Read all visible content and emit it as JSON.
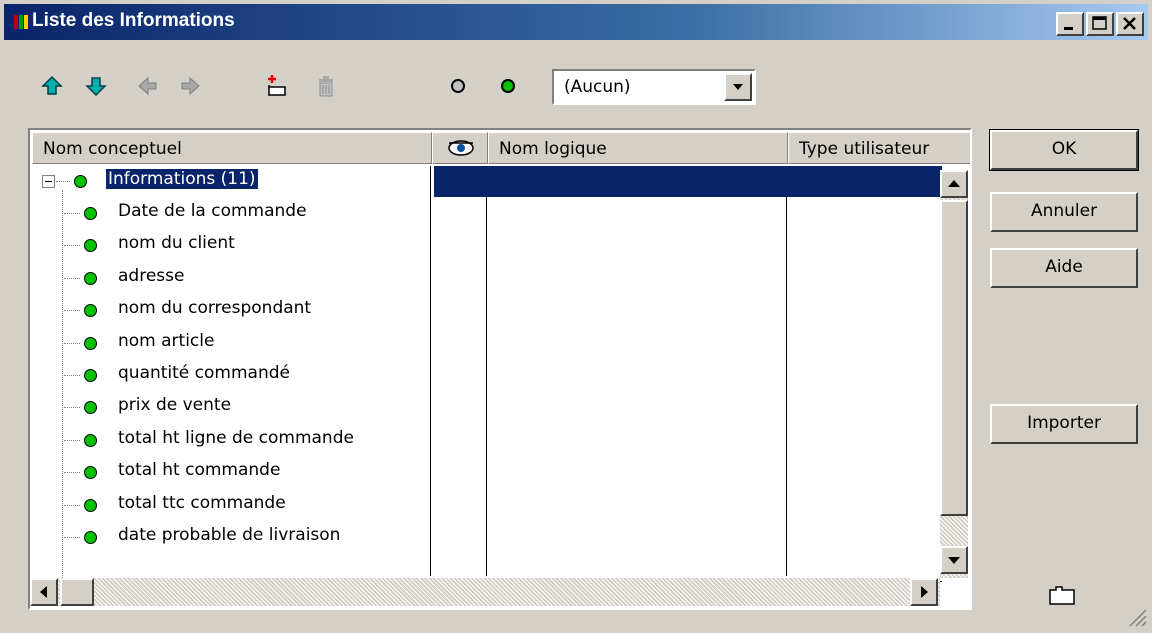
{
  "window": {
    "title": "Liste des Informations"
  },
  "toolbar": {
    "icons": [
      "move-up-icon",
      "move-down-icon",
      "move-left-icon",
      "move-right-icon",
      "add-item-icon",
      "delete-icon",
      "circle-empty-icon",
      "circle-green-icon"
    ],
    "filter_value": "(Aucun)"
  },
  "grid": {
    "columns": [
      "Nom conceptuel",
      "",
      "Nom logique",
      "Type utilisateur"
    ],
    "root": {
      "label": "Informations (11)"
    },
    "items": [
      "Date de la commande",
      "nom du client",
      "adresse",
      "nom du correspondant",
      "nom article",
      "quantité commandé",
      "prix de vente",
      "total ht ligne de commande",
      "total ht commande",
      "total ttc commande",
      "date probable de livraison"
    ]
  },
  "buttons": {
    "ok": "OK",
    "cancel": "Annuler",
    "help": "Aide",
    "import": "Importer"
  },
  "colors": {
    "selection": "#0a246a",
    "status_dot": "#00c000",
    "arrow_up_down": "#00a0a0",
    "arrow_left_right": "#a0a0a0"
  }
}
